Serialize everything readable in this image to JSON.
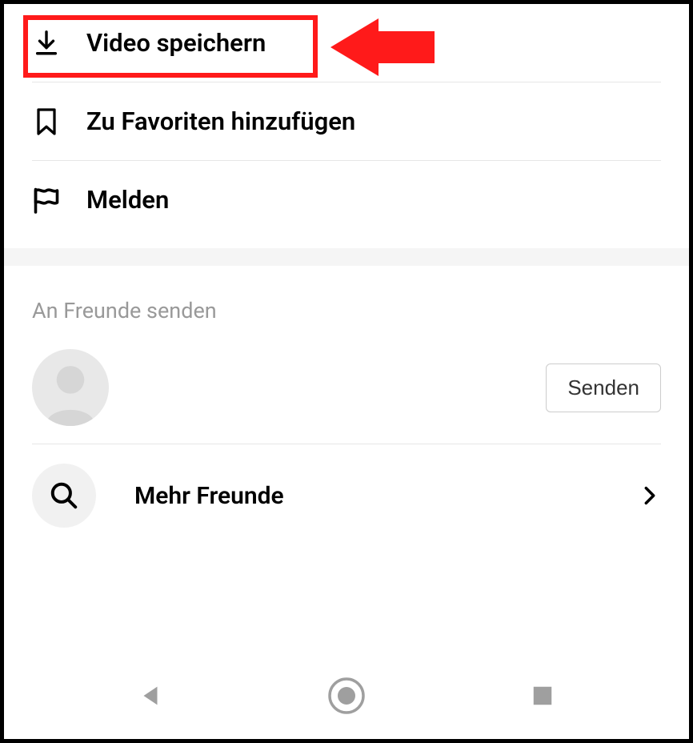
{
  "menu": {
    "save_video": {
      "label": "Video speichern",
      "icon": "download-icon"
    },
    "add_favorites": {
      "label": "Zu Favoriten hinzufügen",
      "icon": "bookmark-icon"
    },
    "report": {
      "label": "Melden",
      "icon": "flag-icon"
    }
  },
  "friends_section": {
    "title": "An Freunde senden",
    "send_button": "Senden",
    "more_friends": "Mehr Freunde"
  },
  "annotation": {
    "highlight_color": "#ff1a1a",
    "arrow_color": "#ff1a1a"
  }
}
